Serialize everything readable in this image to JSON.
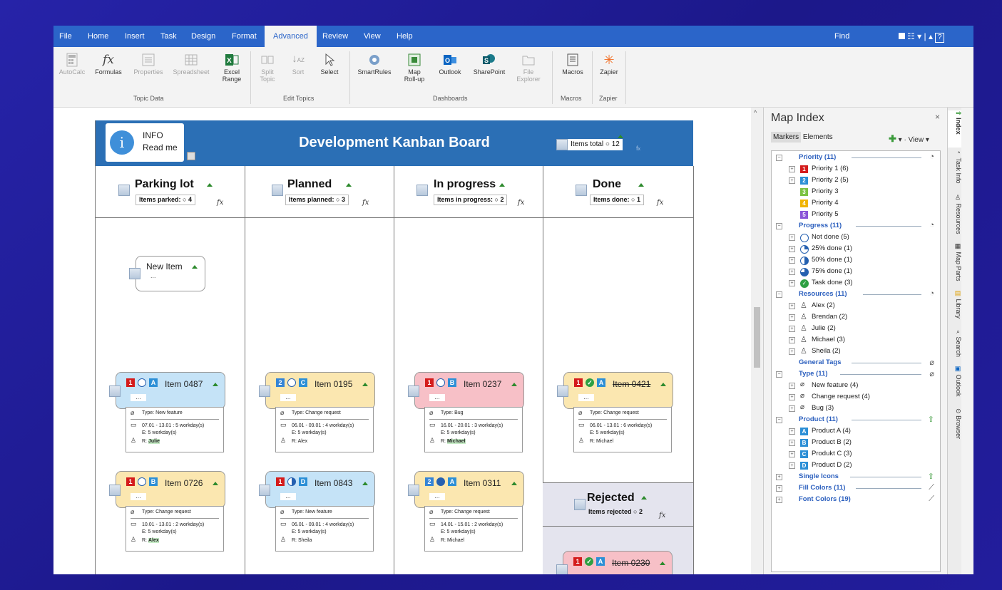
{
  "menu": {
    "items": [
      "File",
      "Home",
      "Insert",
      "Task",
      "Design",
      "Format",
      "Advanced",
      "Review",
      "View",
      "Help"
    ],
    "active": "Advanced",
    "find": "Find"
  },
  "ribbon": {
    "buttons": {
      "autocalc": "AutoCalc",
      "formulas": "Formulas",
      "properties": "Properties",
      "spreadsheet": "Spreadsheet",
      "excel_range_1": "Excel",
      "excel_range_2": "Range",
      "split_topic_1": "Split",
      "split_topic_2": "Topic",
      "sort": "Sort",
      "select": "Select",
      "smartrules": "SmartRules",
      "map_rollup_1": "Map",
      "map_rollup_2": "Roll-up",
      "outlook": "Outlook",
      "sharepoint": "SharePoint",
      "file_explorer_1": "File",
      "file_explorer_2": "Explorer",
      "macros": "Macros",
      "zapier": "Zapier"
    },
    "groups": {
      "topic_data": "Topic Data",
      "edit_topics": "Edit Topics",
      "dashboards": "Dashboards",
      "macros": "Macros",
      "zapier": "Zapier"
    }
  },
  "board": {
    "info_line1": "INFO",
    "info_line2": "Read me",
    "title": "Development Kanban Board",
    "items_total_label": "Items total",
    "items_total": "12",
    "fx": "fx",
    "columns": [
      {
        "title": "Parking lot",
        "count_label": "Items parked:",
        "count": "4"
      },
      {
        "title": "Planned",
        "count_label": "Items planned:",
        "count": "3"
      },
      {
        "title": "In progress",
        "count_label": "Items in progress:",
        "count": "2"
      },
      {
        "title": "Done",
        "count_label": "Items done:",
        "count": "1"
      }
    ],
    "rejected": {
      "title": "Rejected",
      "count_label": "Items rejected",
      "count": "2"
    },
    "new_item": {
      "name": "New Item",
      "dots": "..."
    },
    "cards": [
      {
        "name": "Item 0487",
        "dots": "...",
        "type": "Type: New feature",
        "dates": "07.01 - 13.01 : 5 workday(s)",
        "effort": "E: 5 workday(s)",
        "resource": "R: Julie",
        "resource_prefix": "R: ",
        "resource_name": "Julie"
      },
      {
        "name": "Item 0195",
        "dots": "...",
        "type": "Type: Change request",
        "dates": "06.01 - 09.01 : 4 workday(s)",
        "effort": "E: 5 workday(s)",
        "resource_prefix": "R: ",
        "resource_name": "Alex"
      },
      {
        "name": "Item 0237",
        "dots": "...",
        "type": "Type: Bug",
        "dates": "16.01 - 20.01 : 3 workday(s)",
        "effort": "E: 5 workday(s)",
        "resource_prefix": "R: ",
        "resource_name": "Michael"
      },
      {
        "name": "Item 0421",
        "dots": "...",
        "type": "Type: Change request",
        "dates": "06.01 - 13.01 : 6 workday(s)",
        "effort": "E: 5 workday(s)",
        "resource_prefix": "R: ",
        "resource_name": "Michael"
      },
      {
        "name": "Item 0726",
        "dots": "...",
        "type": "Type: Change request",
        "dates": "10.01 - 13.01 : 2 workday(s)",
        "effort": "E: 5 workday(s)",
        "resource_prefix": "R: ",
        "resource_name": "Alex"
      },
      {
        "name": "Item 0843",
        "dots": "...",
        "type": "Type: New feature",
        "dates": "06.01 - 09.01 : 4 workday(s)",
        "effort": "E: 5 workday(s)",
        "resource_prefix": "R: ",
        "resource_name": "Sheila"
      },
      {
        "name": "Item 0311",
        "dots": "...",
        "type": "Type: Change request",
        "dates": "14.01 - 15.01 : 2 workday(s)",
        "effort": "E: 5 workday(s)",
        "resource_prefix": "R: ",
        "resource_name": "Michael"
      },
      {
        "name": "Item 0230",
        "dots": "..."
      }
    ]
  },
  "panel": {
    "title": "Map Index",
    "close": "×",
    "tab_markers": "Markers",
    "tab_elements": "Elements",
    "view": "View",
    "tree": {
      "priority": "Priority (11)",
      "priority_1": "Priority 1 (6)",
      "priority_2": "Priority 2 (5)",
      "priority_3": "Priority 3",
      "priority_4": "Priority 4",
      "priority_5": "Priority 5",
      "progress": "Progress (11)",
      "not_done": "Not done (5)",
      "p25": "25% done (1)",
      "p50": "50% done (1)",
      "p75": "75% done (1)",
      "task_done": "Task done (3)",
      "resources": "Resources (11)",
      "alex": "Alex (2)",
      "brendan": "Brendan (2)",
      "julie": "Julie (2)",
      "michael": "Michael (3)",
      "sheila": "Sheila (2)",
      "general_tags": "General Tags",
      "type": "Type (11)",
      "new_feature": "New feature (4)",
      "change_request": "Change request (4)",
      "bug": "Bug (3)",
      "product": "Product (11)",
      "product_a": "Product A (4)",
      "product_b": "Product B (2)",
      "product_c": "Produkt C (3)",
      "product_d": "Product D (2)",
      "single_icons": "Single Icons",
      "fill_colors": "Fill Colors (11)",
      "font_colors": "Font Colors (19)"
    }
  },
  "sidetabs": [
    "Index",
    "Task Info",
    "Resources",
    "Map Parts",
    "Library",
    "Search",
    "Outlook",
    "Browser"
  ],
  "colors": {
    "menu_bg": "#2b65c9",
    "board_header": "#2b6fb5",
    "card_blue": "#c5e3f7",
    "card_yellow": "#fbe7b0",
    "card_red": "#f7c0c7",
    "priority_red": "#d41c1c",
    "done_green": "#2ea043"
  }
}
